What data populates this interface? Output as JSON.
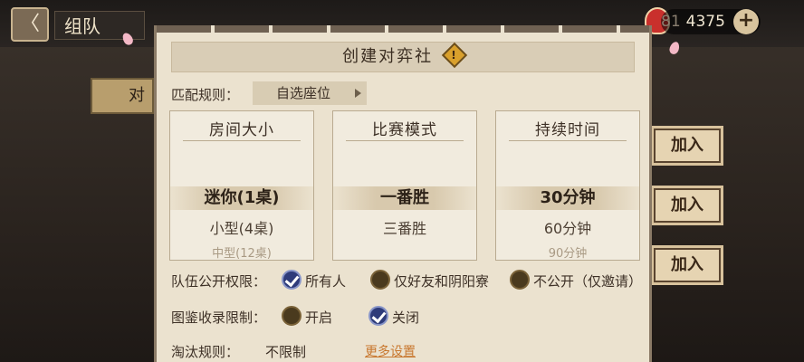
{
  "topbar": {
    "back_label": "〈",
    "title": "组队"
  },
  "currency": {
    "amount_prefix": "81",
    "amount": "4375",
    "add_label": "+"
  },
  "side_label": "对",
  "join_buttons": [
    "加入",
    "加入",
    "加入"
  ],
  "dialog": {
    "title": "创建对弈社",
    "warn_glyph": "!",
    "match_rule_label": "匹配规则：",
    "match_rule_value": "自选座位",
    "pickers": [
      {
        "title": "房间大小",
        "selected": "迷你(1桌)",
        "next": "小型(4桌)",
        "faded": "中型(12桌)"
      },
      {
        "title": "比赛模式",
        "selected": "一番胜",
        "next": "三番胜",
        "faded": ""
      },
      {
        "title": "持续时间",
        "selected": "30分钟",
        "next": "60分钟",
        "faded": "90分钟"
      }
    ],
    "visibility": {
      "label": "队伍公开权限：",
      "options": [
        {
          "text": "所有人",
          "checked": true
        },
        {
          "text": "仅好友和阴阳寮",
          "checked": false
        },
        {
          "text": "不公开（仅邀请）",
          "checked": false
        }
      ]
    },
    "collection": {
      "label": "图鉴收录限制：",
      "options": [
        {
          "text": "开启",
          "checked": false
        },
        {
          "text": "关闭",
          "checked": true
        }
      ]
    },
    "elimination": {
      "label": "淘汰规则：",
      "value": "不限制",
      "more": "更多设置"
    }
  }
}
